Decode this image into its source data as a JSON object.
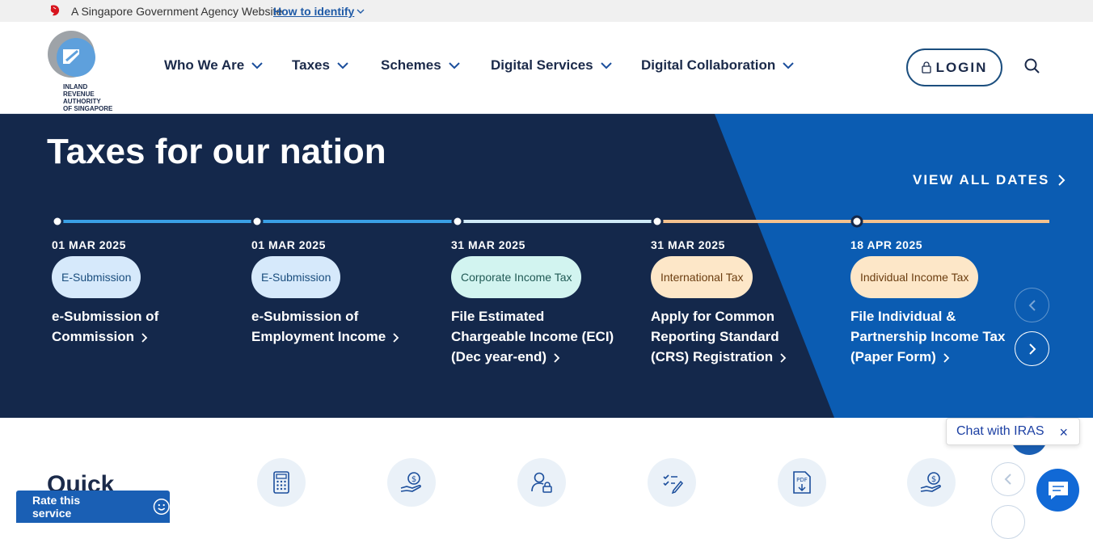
{
  "gov_bar": {
    "text": "A Singapore Government Agency Website",
    "how_to_identify": "How to identify"
  },
  "header": {
    "logo_lines": [
      "INLAND REVENUE",
      "AUTHORITY",
      "OF SINGAPORE"
    ],
    "nav": [
      {
        "label": "Who We Are"
      },
      {
        "label": "Taxes"
      },
      {
        "label": "Schemes"
      },
      {
        "label": "Digital Services"
      },
      {
        "label": "Digital Collaboration"
      }
    ],
    "login_label": "LOGIN"
  },
  "hero": {
    "title": "Taxes for our nation",
    "view_all": "VIEW ALL DATES",
    "events": [
      {
        "date": "01 MAR 2025",
        "tag": "E-Submission",
        "title_lines": [
          "e-Submission of",
          "Commission"
        ]
      },
      {
        "date": "01 MAR 2025",
        "tag": "E-Submission",
        "title_lines": [
          "e-Submission of",
          "Employment Income"
        ]
      },
      {
        "date": "31 MAR 2025",
        "tag": "Corporate Income Tax",
        "title_lines": [
          "File Estimated",
          "Chargeable Income (ECI)",
          "(Dec year-end)"
        ]
      },
      {
        "date": "31 MAR 2025",
        "tag": "International Tax",
        "title_lines": [
          "Apply for Common",
          "Reporting Standard",
          "(CRS) Registration"
        ]
      },
      {
        "date": "18 APR 2025",
        "tag": "Individual Income Tax",
        "title_lines": [
          "File Individual &",
          "Partnership Income Tax",
          "(Paper Form)"
        ]
      }
    ]
  },
  "quick": {
    "title": "Quick",
    "icons": [
      "calculator-icon",
      "hand-money-icon",
      "user-lock-icon",
      "form-checklist-icon",
      "pdf-download-icon",
      "hand-money-icon"
    ]
  },
  "rate": {
    "label": "Rate this service"
  },
  "chat": {
    "label": "Chat with IRAS",
    "close": "×"
  },
  "colors": {
    "navy": "#14284b",
    "blue_panel": "#0b5cb2",
    "tag_blue": "#d6e9fb",
    "tag_teal": "#d2f4f0",
    "tag_orange": "#fde7c8",
    "line_blue": "#3aa0e6",
    "line_light": "#cfeaf7",
    "line_orange": "#f5c28e"
  }
}
